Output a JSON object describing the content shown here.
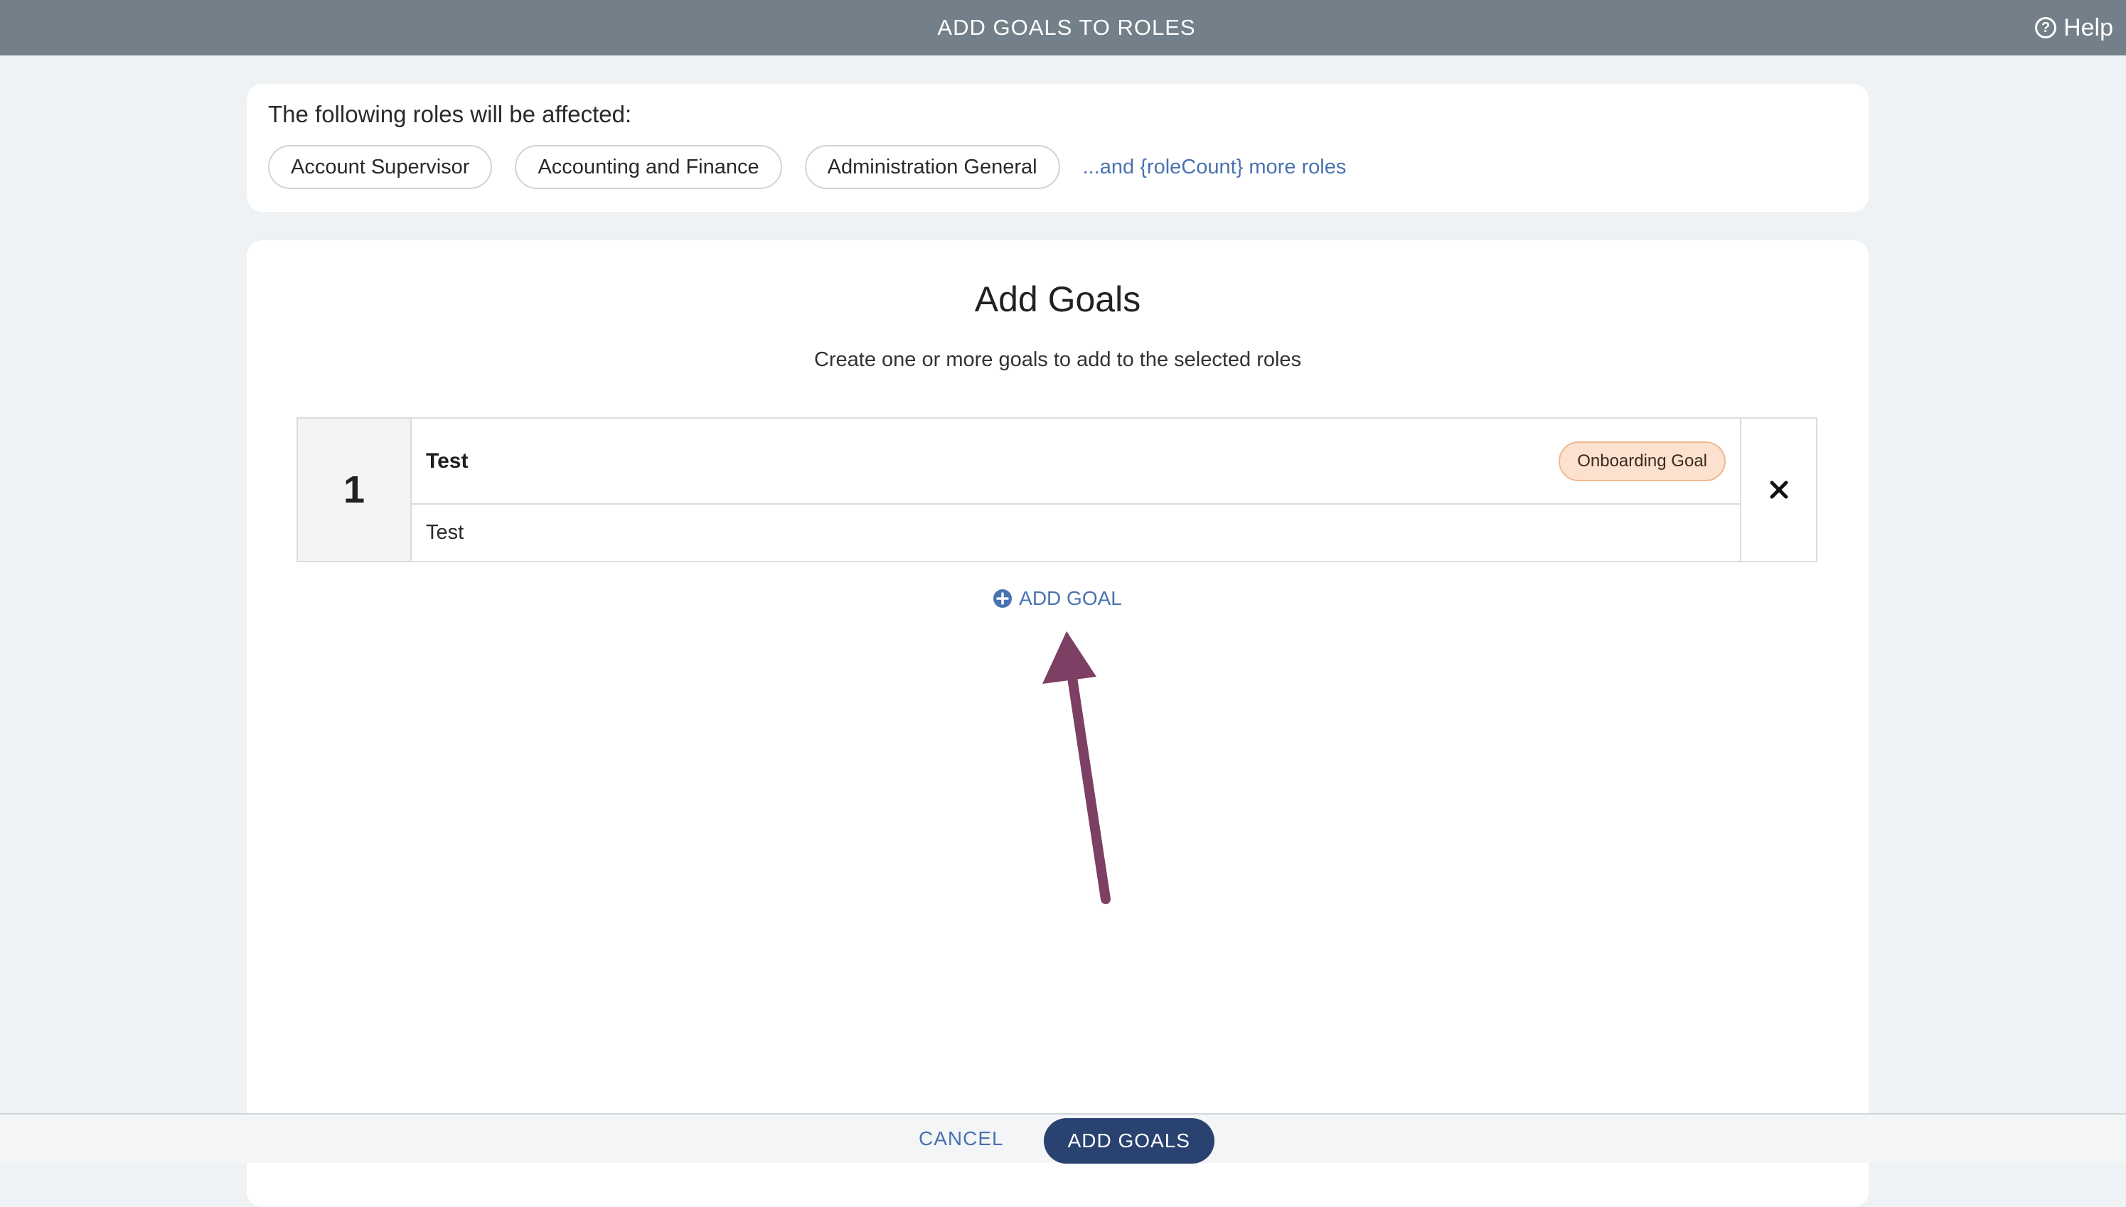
{
  "header": {
    "title": "ADD GOALS TO ROLES",
    "help_label": "Help"
  },
  "roles": {
    "heading": "The following roles will be affected:",
    "chips": [
      "Account Supervisor",
      "Accounting and Finance",
      "Administration General"
    ],
    "more_link": "...and {roleCount} more roles"
  },
  "goals": {
    "title": "Add Goals",
    "subtitle": "Create one or more goals to add to the selected roles",
    "items": [
      {
        "number": "1",
        "title": "Test",
        "badge": "Onboarding Goal",
        "description": "Test"
      }
    ],
    "add_label": "ADD GOAL"
  },
  "footer": {
    "cancel_label": "CANCEL",
    "submit_label": "ADD GOALS"
  },
  "colors": {
    "topbar": "#738089",
    "link": "#4a72b0",
    "primary_button": "#2a4270",
    "badge_bg": "#fde1cf",
    "annotation_arrow": "#7d3f63"
  }
}
